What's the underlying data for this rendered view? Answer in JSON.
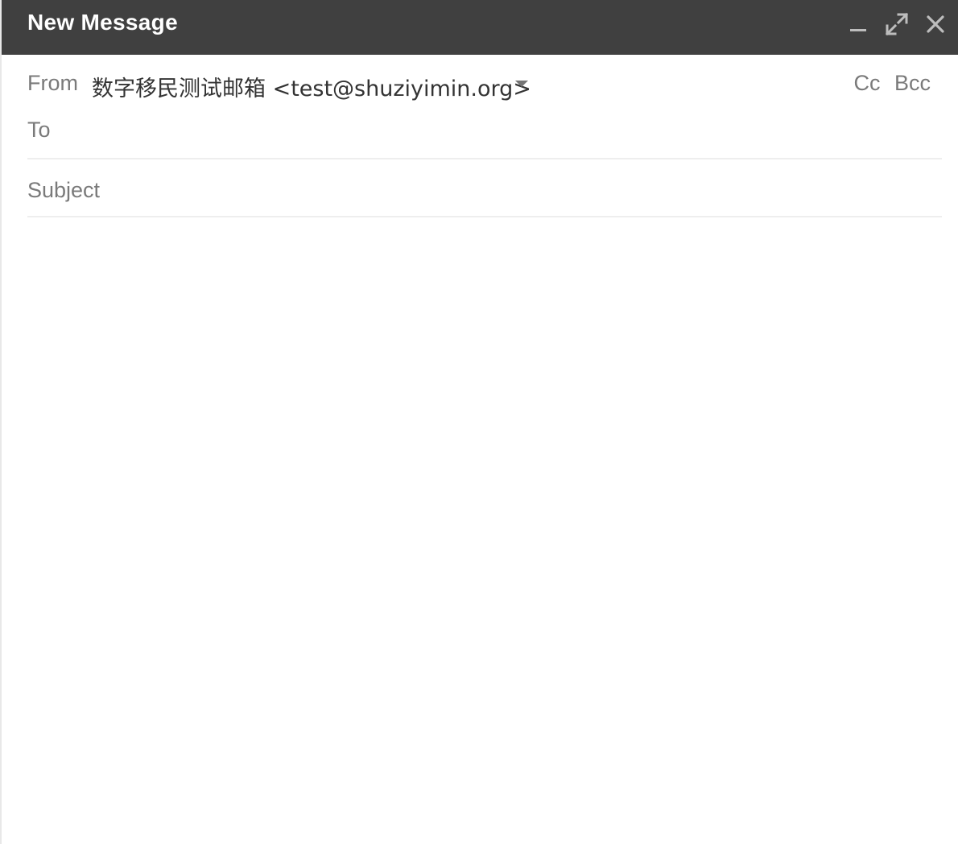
{
  "window": {
    "title": "New Message",
    "minimize_icon": "minimize-icon",
    "expand_icon": "expand-icon",
    "close_icon": "close-icon"
  },
  "compose": {
    "from_label": "From",
    "from_value": "数字移民测试邮箱 <test@shuziyimin.org>",
    "cc_label": "Cc",
    "bcc_label": "Bcc",
    "to_label": "To",
    "to_value": "",
    "subject_placeholder": "Subject",
    "subject_value": "",
    "body_value": ""
  },
  "colors": {
    "titlebar": "#404040",
    "label": "#7a7a7a",
    "divider": "#eeeeee"
  }
}
